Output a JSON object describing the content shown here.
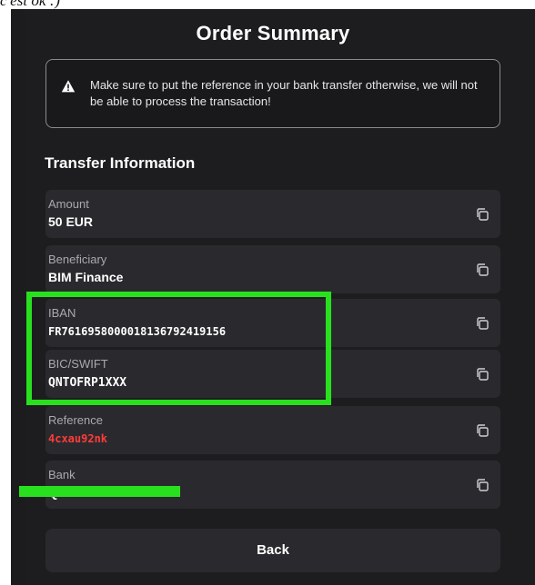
{
  "caption": "c'est ok :)",
  "title": "Order Summary",
  "alert": {
    "icon": "warning-icon",
    "text": "Make sure to put the reference in your bank transfer otherwise, we will not be able to process the transaction!"
  },
  "section_title": "Transfer Information",
  "rows": [
    {
      "label": "Amount",
      "value": "50 EUR"
    },
    {
      "label": "Beneficiary",
      "value": "BIM Finance"
    },
    {
      "label": "IBAN",
      "value": "FR7616958000018136792419156"
    },
    {
      "label": "BIC/SWIFT",
      "value": "QNTOFRP1XXX"
    },
    {
      "label": "Reference",
      "value": "4cxau92nk"
    },
    {
      "label": "Bank",
      "value": "QONTO"
    }
  ],
  "copy_icon": "copy-icon",
  "back_label": "Back",
  "colors": {
    "panel": "#1d1d20",
    "row": "#2a2a2e",
    "highlight": "#29e01f",
    "reference": "#ff3b3b"
  }
}
